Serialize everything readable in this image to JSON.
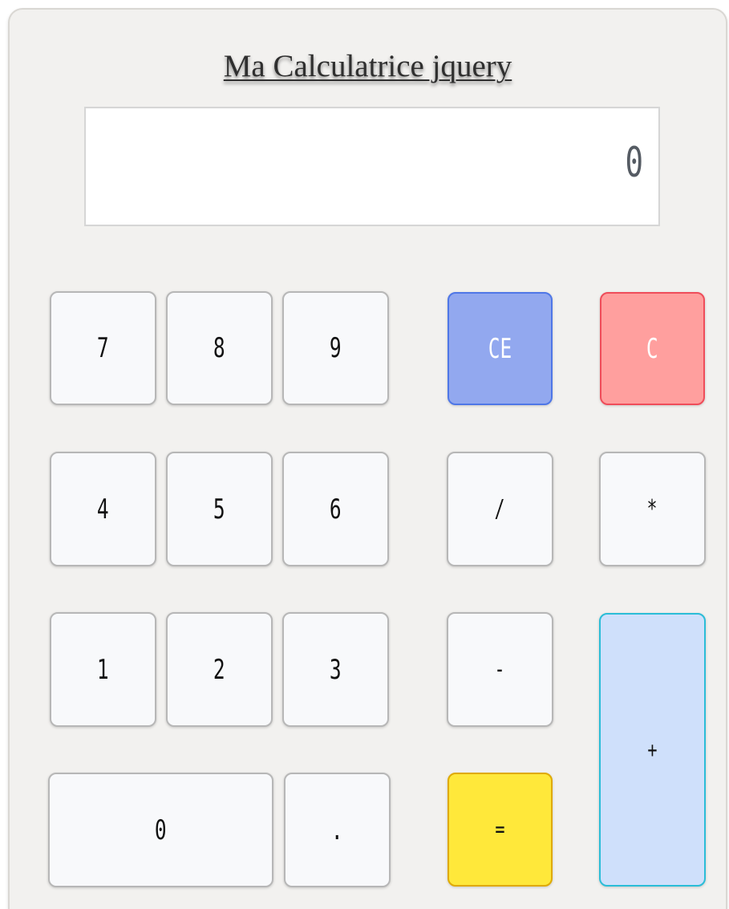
{
  "calculator": {
    "title": "Ma Calculatrice jquery",
    "display": {
      "value": "0"
    },
    "buttons": {
      "seven": "7",
      "eight": "8",
      "nine": "9",
      "clear_entry": "CE",
      "clear": "C",
      "four": "4",
      "five": "5",
      "six": "6",
      "divide": "/",
      "multiply": "*",
      "one": "1",
      "two": "2",
      "three": "3",
      "minus": "-",
      "plus": "+",
      "zero": "0",
      "decimal": ".",
      "equals": "="
    },
    "colors": {
      "background": "#f2f1ef",
      "display_background": "#ffffff",
      "number_button": "#f8f9fb",
      "clear_entry": "#92a8ef",
      "clear": "#ff9f9e",
      "equals": "#ffe83a",
      "plus": "#cfe0fb"
    }
  }
}
